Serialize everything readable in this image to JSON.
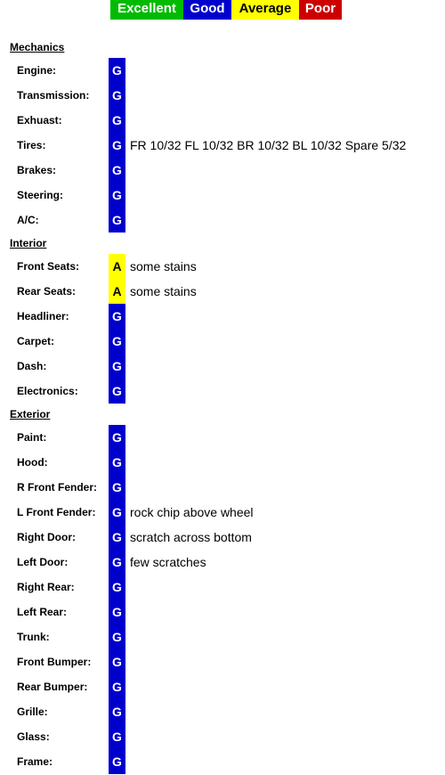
{
  "legend": [
    {
      "label": "Excellent",
      "color": "#00bb00"
    },
    {
      "label": "Good",
      "color": "#0000cc"
    },
    {
      "label": "Average",
      "color": "#ffff00"
    },
    {
      "label": "Poor",
      "color": "#cc0000"
    }
  ],
  "sections": [
    {
      "title": "Mechanics",
      "items": [
        {
          "label": "Engine:",
          "grade": "G",
          "note": ""
        },
        {
          "label": "Transmission:",
          "grade": "G",
          "note": ""
        },
        {
          "label": "Exhuast:",
          "grade": "G",
          "note": ""
        },
        {
          "label": "Tires:",
          "grade": "G",
          "note": "FR 10/32 FL 10/32 BR 10/32 BL 10/32 Spare 5/32"
        },
        {
          "label": "Brakes:",
          "grade": "G",
          "note": ""
        },
        {
          "label": "Steering:",
          "grade": "G",
          "note": ""
        },
        {
          "label": "A/C:",
          "grade": "G",
          "note": ""
        }
      ]
    },
    {
      "title": "Interior",
      "items": [
        {
          "label": "Front Seats:",
          "grade": "A",
          "note": "some stains"
        },
        {
          "label": "Rear Seats:",
          "grade": "A",
          "note": "some stains"
        },
        {
          "label": "Headliner:",
          "grade": "G",
          "note": ""
        },
        {
          "label": "Carpet:",
          "grade": "G",
          "note": ""
        },
        {
          "label": "Dash:",
          "grade": "G",
          "note": ""
        },
        {
          "label": "Electronics:",
          "grade": "G",
          "note": ""
        }
      ]
    },
    {
      "title": "Exterior",
      "items": [
        {
          "label": "Paint:",
          "grade": "G",
          "note": ""
        },
        {
          "label": "Hood:",
          "grade": "G",
          "note": ""
        },
        {
          "label": "R Front Fender:",
          "grade": "G",
          "note": ""
        },
        {
          "label": "L Front Fender:",
          "grade": "G",
          "note": "rock chip above wheel"
        },
        {
          "label": "Right Door:",
          "grade": "G",
          "note": "scratch across bottom"
        },
        {
          "label": "Left Door:",
          "grade": "G",
          "note": "few scratches"
        },
        {
          "label": "Right Rear:",
          "grade": "G",
          "note": ""
        },
        {
          "label": "Left Rear:",
          "grade": "G",
          "note": ""
        },
        {
          "label": "Trunk:",
          "grade": "G",
          "note": ""
        },
        {
          "label": "Front Bumper:",
          "grade": "G",
          "note": ""
        },
        {
          "label": "Rear Bumper:",
          "grade": "G",
          "note": ""
        },
        {
          "label": "Grille:",
          "grade": "G",
          "note": ""
        },
        {
          "label": "Glass:",
          "grade": "G",
          "note": ""
        },
        {
          "label": "Frame:",
          "grade": "G",
          "note": ""
        }
      ]
    }
  ]
}
